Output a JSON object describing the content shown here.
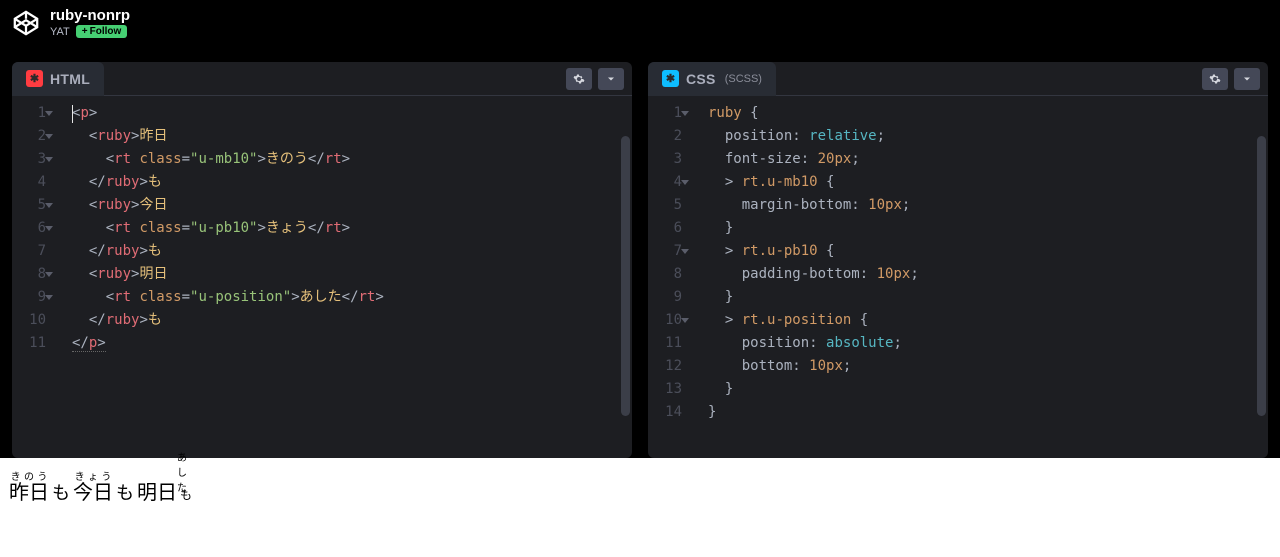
{
  "header": {
    "title": "ruby-nonrp",
    "author": "YAT",
    "follow_label": "Follow"
  },
  "panes": {
    "html": {
      "label": "HTML",
      "lines": [
        "<p>",
        "  <ruby>昨日",
        "    <rt class=\"u-mb10\">きのう</rt>",
        "  </ruby>も",
        "  <ruby>今日",
        "    <rt class=\"u-pb10\">きょう</rt>",
        "  </ruby>も",
        "  <ruby>明日",
        "    <rt class=\"u-position\">あした</rt>",
        "  </ruby>も",
        "</p>"
      ]
    },
    "css": {
      "label": "CSS",
      "sub": "(SCSS)",
      "lines": [
        "ruby {",
        "  position: relative;",
        "  font-size: 20px;",
        "  > rt.u-mb10 {",
        "    margin-bottom: 10px;",
        "  }",
        "  > rt.u-pb10 {",
        "    padding-bottom: 10px;",
        "  }",
        "  > rt.u-position {",
        "    position: absolute;",
        "    bottom: 10px;",
        "  }",
        "}"
      ]
    }
  },
  "result": {
    "words": [
      {
        "base": "昨日",
        "ruby": "きのう"
      },
      {
        "base": "今日",
        "ruby": "きょう"
      },
      {
        "base": "明日",
        "ruby": "あした"
      }
    ],
    "particle": "も"
  }
}
